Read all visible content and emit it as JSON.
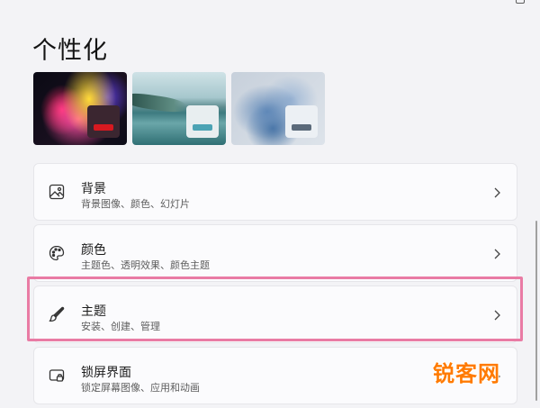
{
  "page": {
    "title": "个性化"
  },
  "themes": [
    {
      "name": "theme-dark-bloom",
      "accent": "#d71920"
    },
    {
      "name": "theme-lake",
      "accent": "#4ba3b4"
    },
    {
      "name": "theme-glow",
      "accent": "#5b6a7a"
    }
  ],
  "settings": [
    {
      "title": "背景",
      "subtitle": "背景图像、颜色、幻灯片",
      "icon": "image-icon"
    },
    {
      "title": "颜色",
      "subtitle": "主题色、透明效果、颜色主题",
      "icon": "palette-icon"
    },
    {
      "title": "主题",
      "subtitle": "安装、创建、管理",
      "icon": "brush-icon"
    },
    {
      "title": "锁屏界面",
      "subtitle": "锁定屏幕图像、应用和动画",
      "icon": "lock-screen-icon"
    }
  ],
  "watermark": "锐客网",
  "colors": {
    "highlight": "#e97ba4",
    "watermark": "#ff7a00"
  }
}
